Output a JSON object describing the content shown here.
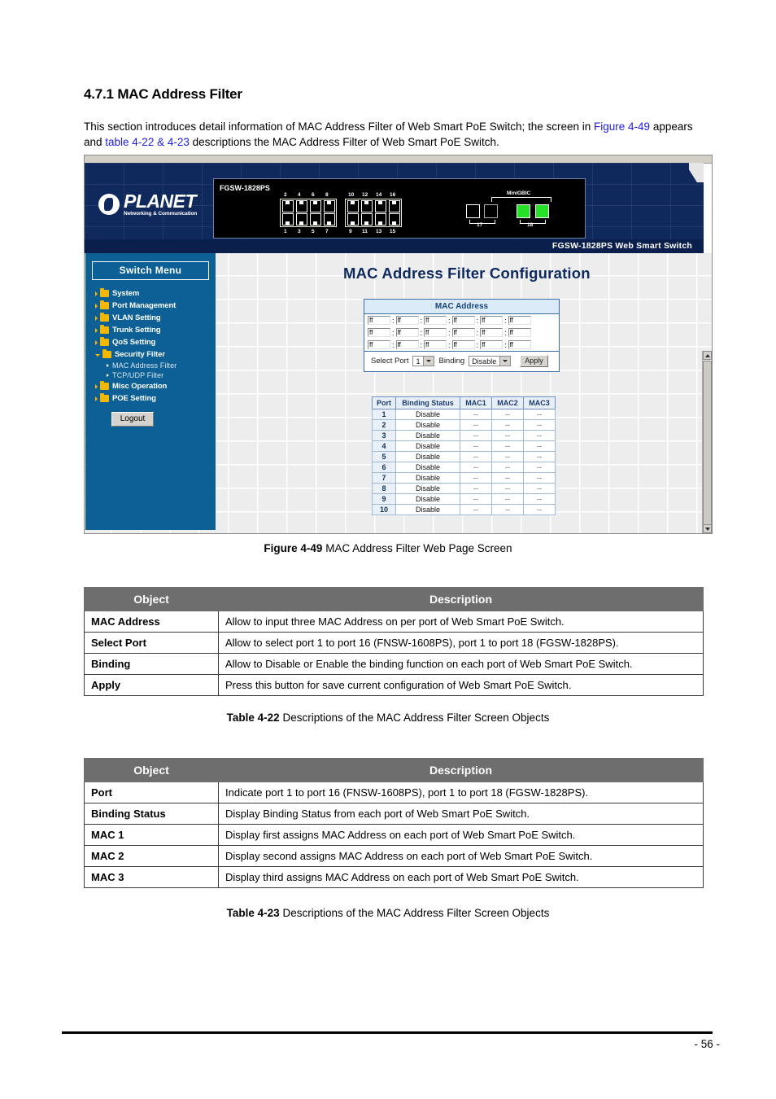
{
  "document": {
    "section_title": "4.7.1 MAC Address Filter",
    "intro_part1": "This section introduces detail information of MAC Address Filter of Web Smart PoE Switch; the screen in ",
    "intro_link1": "Figure 4-49",
    "intro_part2": " appears and ",
    "intro_link2": "table 4-22 & 4-23",
    "intro_part3": " descriptions the MAC Address Filter of Web Smart PoE Switch.",
    "page_number": "- 56 -"
  },
  "figure": {
    "caption_label": "Figure 4-49",
    "caption_text": " MAC Address Filter Web Page Screen"
  },
  "screenshot": {
    "brand": {
      "name": "PLANET",
      "tagline": "Networking & Communication"
    },
    "device": {
      "model": "FGSW-1828PS",
      "top_port_numbers_left": [
        "2",
        "4",
        "6",
        "8"
      ],
      "top_port_numbers_right": [
        "10",
        "12",
        "14",
        "16"
      ],
      "bottom_port_numbers_left": [
        "1",
        "3",
        "5",
        "7"
      ],
      "bottom_port_numbers_right": [
        "9",
        "11",
        "13",
        "15"
      ],
      "sfp_label": "MiniGBIC",
      "sfp_port_left": "17",
      "sfp_port_right": "18"
    },
    "footer_bar": "FGSW-1828PS Web Smart Switch",
    "sidebar": {
      "menu_button": "Switch Menu",
      "items": [
        {
          "label": "System",
          "expanded": false
        },
        {
          "label": "Port Management",
          "expanded": false
        },
        {
          "label": "VLAN Setting",
          "expanded": false
        },
        {
          "label": "Trunk Setting",
          "expanded": false
        },
        {
          "label": "QoS Setting",
          "expanded": false
        },
        {
          "label": "Security Filter",
          "expanded": true
        }
      ],
      "sub_items": [
        {
          "label": "MAC Address Filter"
        },
        {
          "label": "TCP/UDP Filter"
        }
      ],
      "items_after": [
        {
          "label": "Misc Operation",
          "expanded": false
        },
        {
          "label": "POE Setting",
          "expanded": false
        }
      ],
      "logout_label": "Logout"
    },
    "panel": {
      "title": "MAC Address Filter Configuration",
      "mac_table_header": "MAC Address",
      "mac_rows": [
        [
          "ff",
          "ff",
          "ff",
          "ff",
          "ff",
          "ff"
        ],
        [
          "ff",
          "ff",
          "ff",
          "ff",
          "ff",
          "ff"
        ],
        [
          "ff",
          "ff",
          "ff",
          "ff",
          "ff",
          "ff"
        ]
      ],
      "select_port_label": "Select Port",
      "select_port_value": "1",
      "binding_label": "Binding",
      "binding_value": "Disable",
      "apply_label": "Apply"
    },
    "port_table": {
      "headers": [
        "Port",
        "Binding Status",
        "MAC1",
        "MAC2",
        "MAC3"
      ],
      "rows": [
        [
          "1",
          "Disable",
          "--",
          "--",
          "--"
        ],
        [
          "2",
          "Disable",
          "--",
          "--",
          "--"
        ],
        [
          "3",
          "Disable",
          "--",
          "--",
          "--"
        ],
        [
          "4",
          "Disable",
          "--",
          "--",
          "--"
        ],
        [
          "5",
          "Disable",
          "--",
          "--",
          "--"
        ],
        [
          "6",
          "Disable",
          "--",
          "--",
          "--"
        ],
        [
          "7",
          "Disable",
          "--",
          "--",
          "--"
        ],
        [
          "8",
          "Disable",
          "--",
          "--",
          "--"
        ],
        [
          "9",
          "Disable",
          "--",
          "--",
          "--"
        ],
        [
          "10",
          "Disable",
          "--",
          "--",
          "--"
        ]
      ]
    }
  },
  "table_4_22": {
    "headers": [
      "Object",
      "Description"
    ],
    "rows": [
      [
        "MAC Address",
        "Allow to input three MAC Address on per port of Web Smart PoE Switch."
      ],
      [
        "Select Port",
        "Allow to select port 1 to port 16 (FNSW-1608PS), port 1 to port 18 (FGSW-1828PS)."
      ],
      [
        "Binding",
        "Allow to Disable or Enable the binding function on each port of Web Smart PoE Switch."
      ],
      [
        "Apply",
        "Press this button for save current configuration of Web Smart PoE Switch."
      ]
    ],
    "caption_label": "Table 4-22",
    "caption_text": " Descriptions of the MAC Address Filter Screen Objects"
  },
  "table_4_23": {
    "headers": [
      "Object",
      "Description"
    ],
    "rows": [
      [
        "Port",
        "Indicate port 1 to port 16 (FNSW-1608PS),  port 1 to port 18 (FGSW-1828PS)."
      ],
      [
        "Binding Status",
        "Display Binding Status from each port of Web Smart PoE Switch."
      ],
      [
        "MAC 1",
        "Display first assigns MAC Address on each port of Web Smart PoE Switch."
      ],
      [
        "MAC 2",
        "Display second assigns MAC Address on each port of Web Smart PoE Switch."
      ],
      [
        "MAC 3",
        "Display third assigns MAC Address on each port of Web Smart PoE Switch."
      ]
    ],
    "caption_label": "Table 4-23",
    "caption_text": " Descriptions of the MAC Address Filter Screen Objects"
  },
  "colors": {
    "link": "#2020e0",
    "header_navy": "#10295c",
    "sidebar_blue": "#0c6096",
    "panel_title": "#0e2a60",
    "table_header_gray": "#6e6e6e",
    "sfp_green": "#27e02a"
  }
}
